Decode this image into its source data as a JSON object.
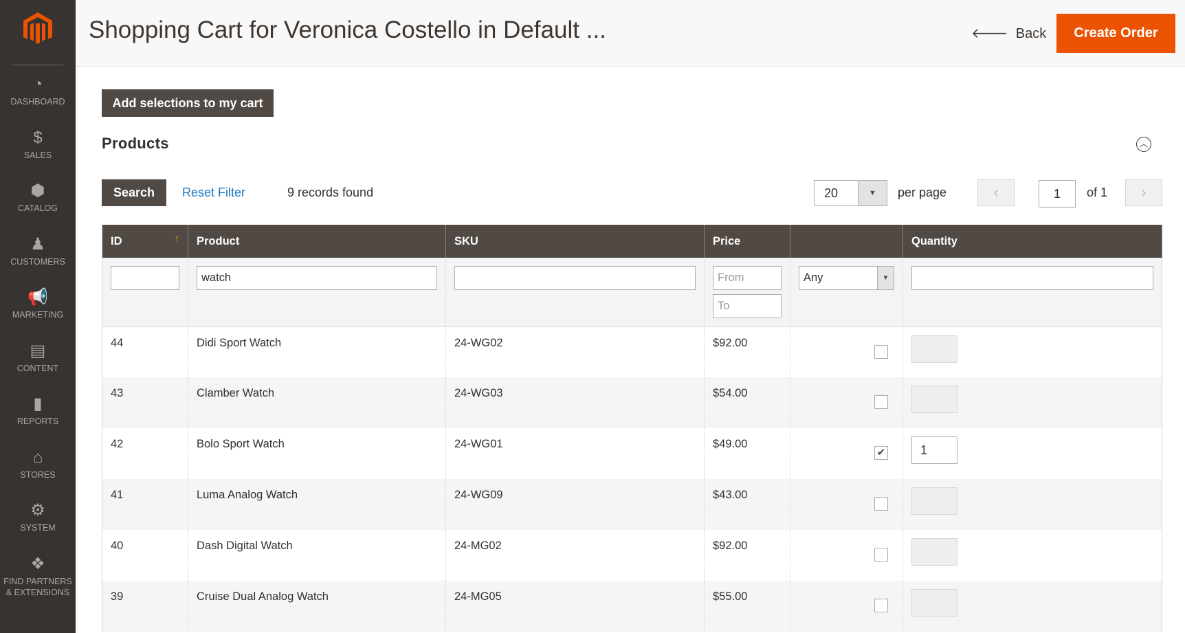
{
  "sidebar": {
    "items": [
      {
        "icon": "dashboard-icon",
        "glyph": "◔",
        "label": "DASHBOARD"
      },
      {
        "icon": "dollar-icon",
        "glyph": "$",
        "label": "SALES"
      },
      {
        "icon": "box-icon",
        "glyph": "⬢",
        "label": "CATALOG"
      },
      {
        "icon": "person-icon",
        "glyph": "♟",
        "label": "CUSTOMERS"
      },
      {
        "icon": "megaphone-icon",
        "glyph": "📢",
        "label": "MARKETING"
      },
      {
        "icon": "layout-icon",
        "glyph": "▤",
        "label": "CONTENT"
      },
      {
        "icon": "bar-chart-icon",
        "glyph": "▮",
        "label": "REPORTS"
      },
      {
        "icon": "store-icon",
        "glyph": "⌂",
        "label": "STORES"
      },
      {
        "icon": "gear-icon",
        "glyph": "⚙",
        "label": "SYSTEM"
      },
      {
        "icon": "blocks-icon",
        "glyph": "❖",
        "label": "FIND PARTNERS & EXTENSIONS"
      }
    ]
  },
  "header": {
    "title": "Shopping Cart for Veronica Costello in Default ...",
    "back_label": "Back",
    "create_label": "Create Order"
  },
  "actions": {
    "add_selections": "Add selections to my cart"
  },
  "section": {
    "title": "Products"
  },
  "toolbar": {
    "search": "Search",
    "reset": "Reset Filter",
    "records": "9 records found",
    "per_page_value": "20",
    "per_page_label": "per page",
    "page": "1",
    "of_pages": "of 1"
  },
  "table": {
    "columns": [
      "ID",
      "Product",
      "SKU",
      "Price",
      "",
      "Quantity"
    ],
    "filters": {
      "id": "",
      "product": "watch",
      "sku": "",
      "price_from_ph": "From",
      "price_to_ph": "To",
      "select": "Any",
      "quantity": ""
    },
    "rows": [
      {
        "id": "44",
        "product": "Didi Sport Watch",
        "sku": "24-WG02",
        "price": "$92.00",
        "checked": false,
        "qty": ""
      },
      {
        "id": "43",
        "product": "Clamber Watch",
        "sku": "24-WG03",
        "price": "$54.00",
        "checked": false,
        "qty": ""
      },
      {
        "id": "42",
        "product": "Bolo Sport Watch",
        "sku": "24-WG01",
        "price": "$49.00",
        "checked": true,
        "qty": "1"
      },
      {
        "id": "41",
        "product": "Luma Analog Watch",
        "sku": "24-WG09",
        "price": "$43.00",
        "checked": false,
        "qty": ""
      },
      {
        "id": "40",
        "product": "Dash Digital Watch",
        "sku": "24-MG02",
        "price": "$92.00",
        "checked": false,
        "qty": ""
      },
      {
        "id": "39",
        "product": "Cruise Dual Analog Watch",
        "sku": "24-MG05",
        "price": "$55.00",
        "checked": false,
        "qty": ""
      }
    ]
  },
  "colors": {
    "accent": "#eb5202",
    "dark": "#514943",
    "sidebar": "#373330",
    "link": "#1979c3"
  }
}
